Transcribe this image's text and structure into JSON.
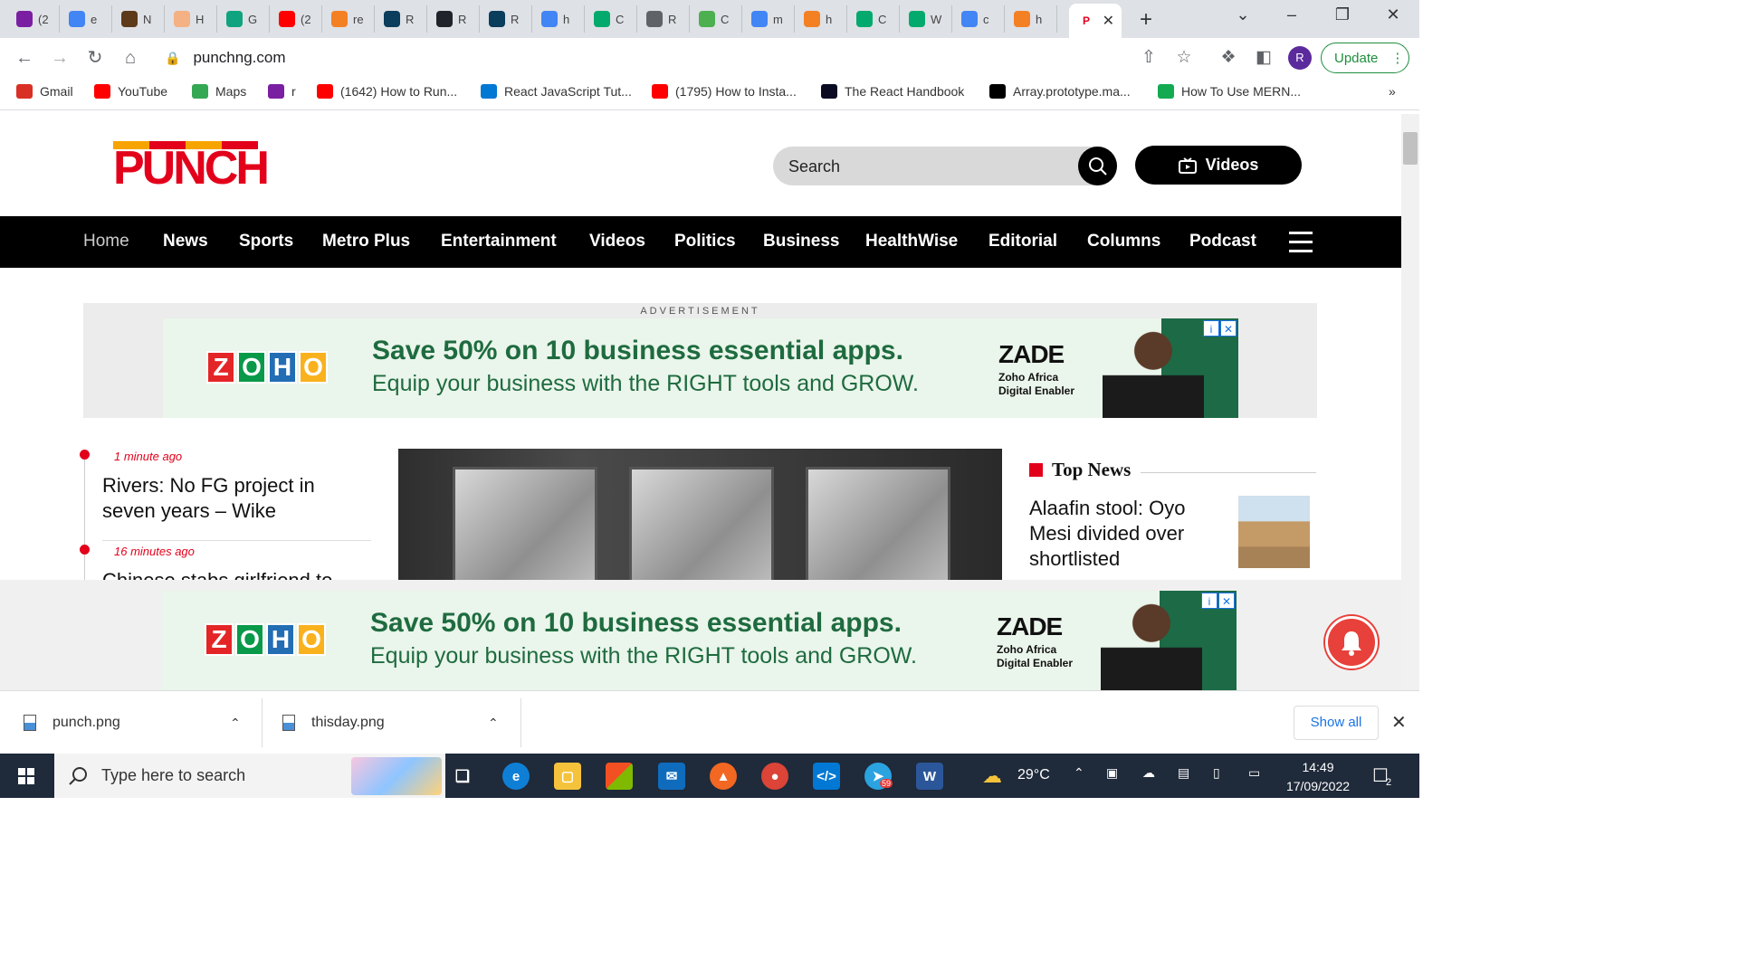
{
  "browser": {
    "tabs": [
      {
        "icon": "gmail-icon",
        "label": "(2",
        "color": "#7b1fa2"
      },
      {
        "icon": "google-icon",
        "label": "e",
        "color": "#4285f4"
      },
      {
        "icon": "book-icon",
        "label": "N",
        "color": "#5d3a1a"
      },
      {
        "icon": "hand-icon",
        "label": "H",
        "color": "#f4b183"
      },
      {
        "icon": "openai-icon",
        "label": "G",
        "color": "#10a37f"
      },
      {
        "icon": "youtube-icon",
        "label": "(2",
        "color": "#ff0000"
      },
      {
        "icon": "stackoverflow-icon",
        "label": "re",
        "color": "#f48024"
      },
      {
        "icon": "react-icon",
        "label": "R",
        "color": "#0b3d5c"
      },
      {
        "icon": "react-icon",
        "label": "R",
        "color": "#20232a"
      },
      {
        "icon": "react-icon",
        "label": "R",
        "color": "#0b3d5c"
      },
      {
        "icon": "google-icon",
        "label": "h",
        "color": "#4285f4"
      },
      {
        "icon": "w3schools-icon",
        "label": "C",
        "color": "#04aa6d"
      },
      {
        "icon": "globe-icon",
        "label": "R",
        "color": "#5f6368"
      },
      {
        "icon": "code-icon",
        "label": "C",
        "color": "#4caf50"
      },
      {
        "icon": "google-icon",
        "label": "m",
        "color": "#4285f4"
      },
      {
        "icon": "stackoverflow-icon",
        "label": "h",
        "color": "#f48024"
      },
      {
        "icon": "w3schools-icon",
        "label": "C",
        "color": "#04aa6d"
      },
      {
        "icon": "w3schools-icon",
        "label": "W",
        "color": "#04aa6d"
      },
      {
        "icon": "google-icon",
        "label": "c",
        "color": "#4285f4"
      },
      {
        "icon": "stackoverflow-icon",
        "label": "h",
        "color": "#f48024"
      }
    ],
    "active_tab": {
      "icon": "punch-icon",
      "label": "P"
    },
    "url": "punchng.com",
    "update_label": "Update",
    "profile_initial": "R",
    "bookmarks": [
      {
        "icon": "gmail-icon",
        "label": "Gmail",
        "color": "#d93025"
      },
      {
        "icon": "youtube-icon",
        "label": "YouTube",
        "color": "#ff0000"
      },
      {
        "icon": "maps-icon",
        "label": "Maps",
        "color": "#34a853"
      },
      {
        "icon": "mail-icon",
        "label": "r",
        "color": "#7b1fa2"
      },
      {
        "icon": "youtube-icon",
        "label": "(1642) How to Run...",
        "color": "#ff0000"
      },
      {
        "icon": "vscode-icon",
        "label": "React JavaScript Tut...",
        "color": "#0078d4"
      },
      {
        "icon": "youtube-icon",
        "label": "(1795) How to Insta...",
        "color": "#ff0000"
      },
      {
        "icon": "freecodecamp-icon",
        "label": "The React Handbook",
        "color": "#0a0a23"
      },
      {
        "icon": "mdn-icon",
        "label": "Array.prototype.ma...",
        "color": "#000000"
      },
      {
        "icon": "mongodb-icon",
        "label": "How To Use MERN...",
        "color": "#13aa52"
      }
    ]
  },
  "site": {
    "logo_text": "PUNCH",
    "search_placeholder": "Search",
    "videos_label": "Videos",
    "nav": [
      "Home",
      "News",
      "Sports",
      "Metro Plus",
      "Entertainment",
      "Videos",
      "Politics",
      "Business",
      "HealthWise",
      "Editorial",
      "Columns",
      "Podcast"
    ],
    "ad_label": "ADVERTISEMENT",
    "ad": {
      "logo_letters": [
        "Z",
        "O",
        "H",
        "O"
      ],
      "headline": "Save 50% on 10 business essential apps.",
      "subline": "Equip your business with the RIGHT tools and GROW.",
      "zade": "ZADE",
      "zade_sub1": "Zoho Africa",
      "zade_sub2": "Digital Enabler"
    },
    "latest": [
      {
        "time": "1 minute ago",
        "title": "Rivers: No FG project in seven years – Wike"
      },
      {
        "time": "16 minutes ago",
        "title": "Chinese stabs girlfriend to"
      }
    ],
    "top_news_title": "Top News",
    "top_news_story": "Alaafin stool: Oyo Mesi divided over shortlisted"
  },
  "downloads": {
    "items": [
      "punch.png",
      "thisday.png"
    ],
    "show_all": "Show all"
  },
  "taskbar": {
    "search_placeholder": "Type here to search",
    "weather": "29°C",
    "time": "14:49",
    "date": "17/09/2022",
    "notification_count": "2",
    "telegram_badge": "59"
  },
  "colors": {
    "punch_red": "#e3001b",
    "nav_bg": "#000000",
    "zoho_green": "#1e6b3f"
  }
}
